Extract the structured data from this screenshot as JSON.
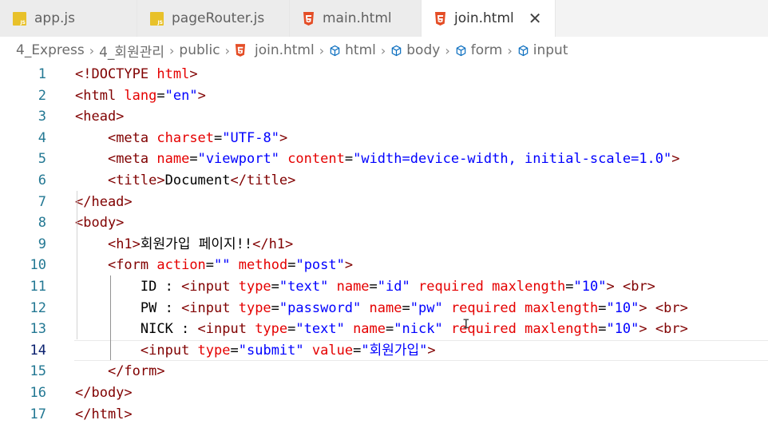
{
  "tabs": [
    {
      "label": "app.js",
      "icon": "js-file-icon",
      "active": false
    },
    {
      "label": "pageRouter.js",
      "icon": "js-file-icon",
      "active": false
    },
    {
      "label": "main.html",
      "icon": "html5-file-icon",
      "active": false
    },
    {
      "label": "join.html",
      "icon": "html5-file-icon",
      "active": true
    }
  ],
  "tab_close": "✕",
  "breadcrumb": [
    "4_Express",
    "4_회원관리",
    "public",
    "join.html",
    "html",
    "body",
    "form",
    "input"
  ],
  "breadcrumb_sep": "›",
  "current_line": 14,
  "lines": [
    {
      "n": "1",
      "segs": [
        [
          "t-tag",
          "<!DOCTYPE "
        ],
        [
          "t-attr",
          "html"
        ],
        [
          "t-tag",
          ">"
        ]
      ]
    },
    {
      "n": "2",
      "segs": [
        [
          "t-tag",
          "<html "
        ],
        [
          "t-attr",
          "lang"
        ],
        [
          "t-txt",
          "="
        ],
        [
          "t-val",
          "\"en\""
        ],
        [
          "t-tag",
          ">"
        ]
      ]
    },
    {
      "n": "3",
      "segs": [
        [
          "t-tag",
          "<head>"
        ]
      ]
    },
    {
      "n": "4",
      "segs": [
        [
          "t-txt",
          "    "
        ],
        [
          "t-tag",
          "<meta "
        ],
        [
          "t-attr",
          "charset"
        ],
        [
          "t-txt",
          "="
        ],
        [
          "t-val",
          "\"UTF-8\""
        ],
        [
          "t-tag",
          ">"
        ]
      ]
    },
    {
      "n": "5",
      "segs": [
        [
          "t-txt",
          "    "
        ],
        [
          "t-tag",
          "<meta "
        ],
        [
          "t-attr",
          "name"
        ],
        [
          "t-txt",
          "="
        ],
        [
          "t-val",
          "\"viewport\""
        ],
        [
          "t-txt",
          " "
        ],
        [
          "t-attr",
          "content"
        ],
        [
          "t-txt",
          "="
        ],
        [
          "t-val",
          "\"width=device-width, initial-scale=1.0\""
        ],
        [
          "t-tag",
          ">"
        ]
      ]
    },
    {
      "n": "6",
      "segs": [
        [
          "t-txt",
          "    "
        ],
        [
          "t-tag",
          "<title>"
        ],
        [
          "t-txt",
          "Document"
        ],
        [
          "t-tag",
          "</title>"
        ]
      ]
    },
    {
      "n": "7",
      "segs": [
        [
          "t-tag",
          "</head>"
        ]
      ]
    },
    {
      "n": "8",
      "segs": [
        [
          "t-tag",
          "<body>"
        ]
      ]
    },
    {
      "n": "9",
      "segs": [
        [
          "t-txt",
          "    "
        ],
        [
          "t-tag",
          "<h1>"
        ],
        [
          "t-txt",
          "회원가입 페이지!!"
        ],
        [
          "t-tag",
          "</h1>"
        ]
      ]
    },
    {
      "n": "10",
      "segs": [
        [
          "t-txt",
          "    "
        ],
        [
          "t-tag",
          "<form "
        ],
        [
          "t-attr",
          "action"
        ],
        [
          "t-txt",
          "="
        ],
        [
          "t-val",
          "\"\""
        ],
        [
          "t-txt",
          " "
        ],
        [
          "t-attr",
          "method"
        ],
        [
          "t-txt",
          "="
        ],
        [
          "t-val",
          "\"post\""
        ],
        [
          "t-tag",
          ">"
        ]
      ]
    },
    {
      "n": "11",
      "segs": [
        [
          "t-txt",
          "        ID : "
        ],
        [
          "t-tag",
          "<input "
        ],
        [
          "t-attr",
          "type"
        ],
        [
          "t-txt",
          "="
        ],
        [
          "t-val",
          "\"text\""
        ],
        [
          "t-txt",
          " "
        ],
        [
          "t-attr",
          "name"
        ],
        [
          "t-txt",
          "="
        ],
        [
          "t-val",
          "\"id\""
        ],
        [
          "t-txt",
          " "
        ],
        [
          "t-attr",
          "required"
        ],
        [
          "t-txt",
          " "
        ],
        [
          "t-attr",
          "maxlength"
        ],
        [
          "t-txt",
          "="
        ],
        [
          "t-val",
          "\"10\""
        ],
        [
          "t-tag",
          ">"
        ],
        [
          "t-txt",
          " "
        ],
        [
          "t-tag",
          "<br>"
        ]
      ]
    },
    {
      "n": "12",
      "segs": [
        [
          "t-txt",
          "        PW : "
        ],
        [
          "t-tag",
          "<input "
        ],
        [
          "t-attr",
          "type"
        ],
        [
          "t-txt",
          "="
        ],
        [
          "t-val",
          "\"password\""
        ],
        [
          "t-txt",
          " "
        ],
        [
          "t-attr",
          "name"
        ],
        [
          "t-txt",
          "="
        ],
        [
          "t-val",
          "\"pw\""
        ],
        [
          "t-txt",
          " "
        ],
        [
          "t-attr",
          "required"
        ],
        [
          "t-txt",
          " "
        ],
        [
          "t-attr",
          "maxlength"
        ],
        [
          "t-txt",
          "="
        ],
        [
          "t-val",
          "\"10\""
        ],
        [
          "t-tag",
          ">"
        ],
        [
          "t-txt",
          " "
        ],
        [
          "t-tag",
          "<br>"
        ]
      ]
    },
    {
      "n": "13",
      "segs": [
        [
          "t-txt",
          "        NICK : "
        ],
        [
          "t-tag",
          "<input "
        ],
        [
          "t-attr",
          "type"
        ],
        [
          "t-txt",
          "="
        ],
        [
          "t-val",
          "\"text\""
        ],
        [
          "t-txt",
          " "
        ],
        [
          "t-attr",
          "name"
        ],
        [
          "t-txt",
          "="
        ],
        [
          "t-val",
          "\"nick\""
        ],
        [
          "t-txt",
          " "
        ],
        [
          "t-attr",
          "required"
        ],
        [
          "t-txt",
          " "
        ],
        [
          "t-attr",
          "maxlength"
        ],
        [
          "t-txt",
          "="
        ],
        [
          "t-val",
          "\"10\""
        ],
        [
          "t-tag",
          ">"
        ],
        [
          "t-txt",
          " "
        ],
        [
          "t-tag",
          "<br>"
        ]
      ]
    },
    {
      "n": "14",
      "segs": [
        [
          "t-txt",
          "        "
        ],
        [
          "t-tag",
          "<input "
        ],
        [
          "t-attr",
          "type"
        ],
        [
          "t-txt",
          "="
        ],
        [
          "t-val",
          "\"submit\""
        ],
        [
          "t-txt",
          " "
        ],
        [
          "t-attr",
          "value"
        ],
        [
          "t-txt",
          "="
        ],
        [
          "t-val",
          "\"회원가입\""
        ],
        [
          "t-tag",
          ">"
        ]
      ]
    },
    {
      "n": "15",
      "segs": [
        [
          "t-txt",
          "    "
        ],
        [
          "t-tag",
          "</form>"
        ]
      ]
    },
    {
      "n": "16",
      "segs": [
        [
          "t-tag",
          "</body>"
        ]
      ]
    },
    {
      "n": "17",
      "segs": [
        [
          "t-tag",
          "</html>"
        ]
      ]
    }
  ],
  "colors": {
    "tag": "#800000",
    "attribute": "#e50000",
    "value": "#0000ff",
    "text": "#000000",
    "line_number": "#237893"
  }
}
